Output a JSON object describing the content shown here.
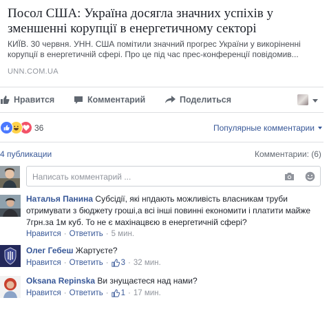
{
  "preview": {
    "title": "Посол США: Україна досягла значних успіхів у зменшенні корупції в енергетичному секторі",
    "description": "КИЇВ. 30 червня. УНН. США помітили значний прогрес України у викоріненні корупції в енергетичній сфері. Про це під час прес-конференції повідомив...",
    "source": "UNN.COM.UA"
  },
  "actions": {
    "like": "Нравится",
    "comment": "Комментарий",
    "share": "Поделиться"
  },
  "reactions": {
    "count": "36",
    "sort_label": "Популярные комментарии"
  },
  "stats": {
    "publications": "4 публикации",
    "comments": "Комментарии: (6)"
  },
  "composer": {
    "placeholder": "Написать комментарий ..."
  },
  "comments": [
    {
      "author": "Наталья Панина",
      "text": " Субсідії, які нпдають можливість власникам труби отримувати з бюджету гроші,а всі інші повинні економити і платити майже 7грн.за 1м куб. То не є махінацвєю в енергетичній сфері?",
      "reply": "Нравится",
      "answer": "Ответить",
      "time": "5 мин.",
      "likes": ""
    },
    {
      "author": "Олег Гебеш",
      "text": " Жартуєте?",
      "reply": "Нравится",
      "answer": "Ответить",
      "time": "32 мин.",
      "likes": "3"
    },
    {
      "author": "Oksana Repinska",
      "text": " Ви знущаєтеся над нами?",
      "reply": "Нравится",
      "answer": "Ответить",
      "time": "17 мин.",
      "likes": "1"
    }
  ],
  "colors": {
    "link": "#385898",
    "muted": "#90949c",
    "like_blue": "#4a78ff",
    "love_red": "#f25268",
    "haha_yellow": "#ffd24a"
  }
}
